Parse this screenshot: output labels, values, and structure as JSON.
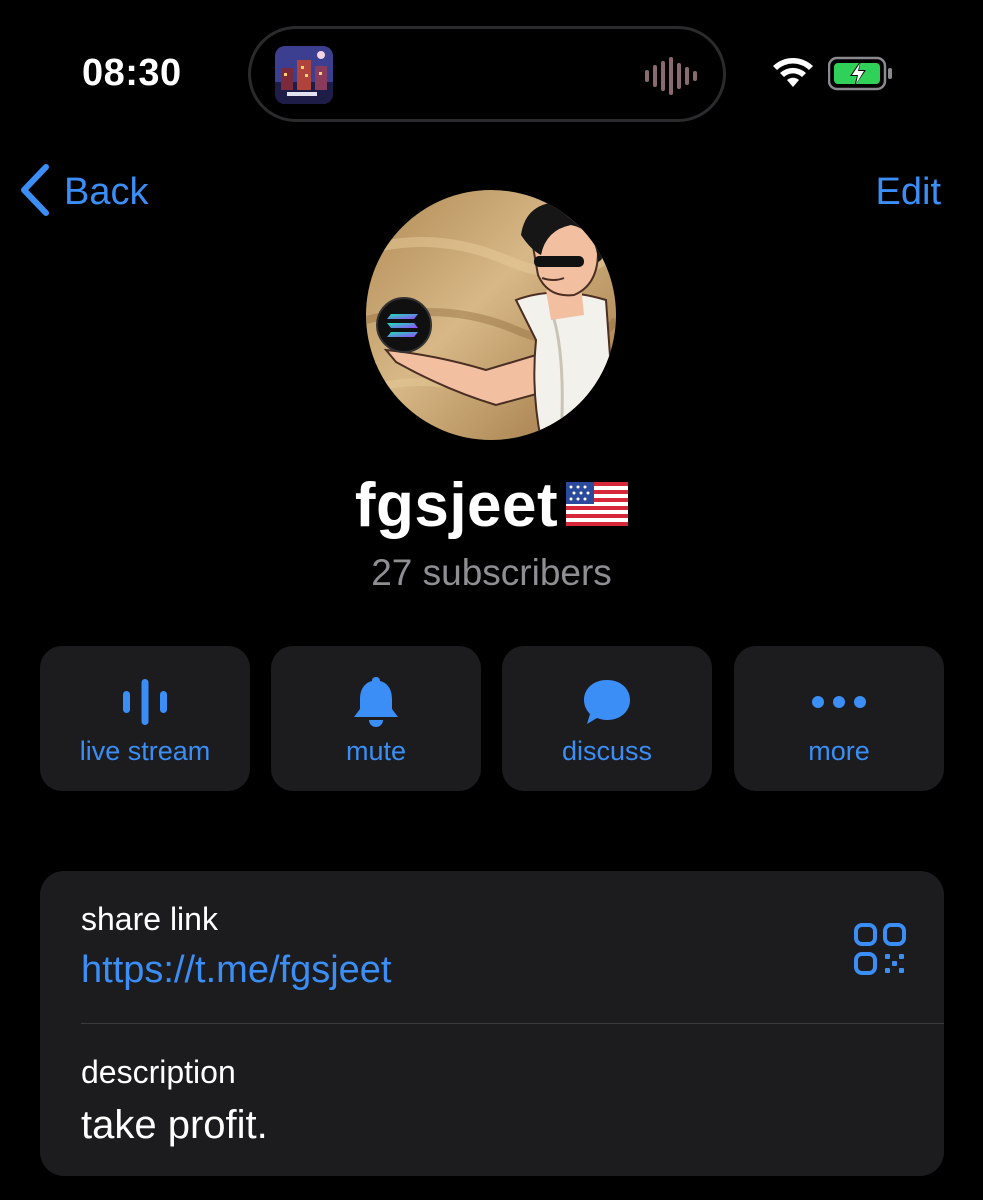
{
  "status_bar": {
    "time": "08:30"
  },
  "nav": {
    "back_label": "Back",
    "edit_label": "Edit"
  },
  "profile": {
    "name": "fgsjeet",
    "subscribers": "27 subscribers"
  },
  "actions": [
    {
      "label": "live stream",
      "icon": "live-stream-icon"
    },
    {
      "label": "mute",
      "icon": "bell-icon"
    },
    {
      "label": "discuss",
      "icon": "chat-bubble-icon"
    },
    {
      "label": "more",
      "icon": "more-dots-icon"
    }
  ],
  "info": {
    "share_caption": "share link",
    "share_url": "https://t.me/fgsjeet",
    "description_caption": "description",
    "description": "take profit."
  },
  "colors": {
    "accent": "#3a8ef6",
    "background": "#000000",
    "card": "#1c1c1e",
    "secondary_text": "#8e8e93"
  }
}
